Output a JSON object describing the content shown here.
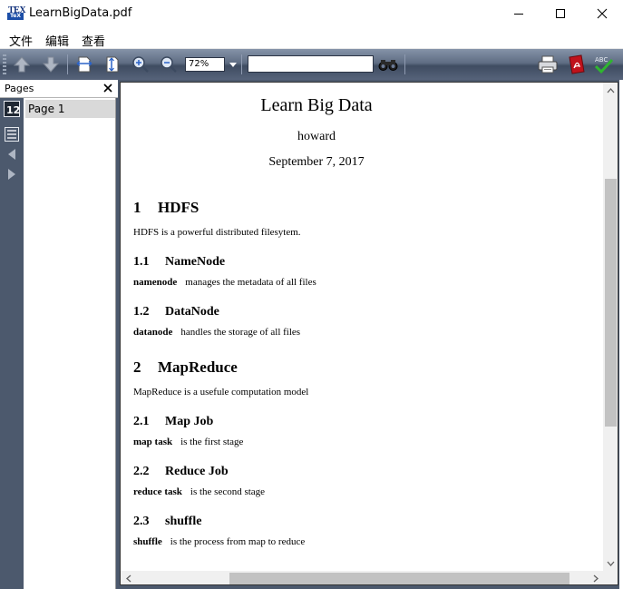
{
  "window": {
    "title": "LearnBigData.pdf",
    "app_icon_top": "TEX",
    "app_icon_bottom": "TeX"
  },
  "menu": {
    "items": [
      {
        "label": "文件"
      },
      {
        "label": "编辑"
      },
      {
        "label": "查看"
      }
    ]
  },
  "toolbar": {
    "zoom_value": "72%",
    "search_value": ""
  },
  "pages_panel": {
    "title": "Pages",
    "page_number_icon": "12",
    "items": [
      {
        "label": "Page 1"
      }
    ]
  },
  "document": {
    "title": "Learn Big Data",
    "author": "howard",
    "date": "September 7, 2017",
    "sections": [
      {
        "num": "1",
        "title": "HDFS",
        "text": "HDFS is a powerful distributed filesytem.",
        "subsections": [
          {
            "num": "1.1",
            "title": "NameNode",
            "term": "namenode",
            "text": "manages the metadata of all files"
          },
          {
            "num": "1.2",
            "title": "DataNode",
            "term": "datanode",
            "text": "handles the storage of all files"
          }
        ]
      },
      {
        "num": "2",
        "title": "MapReduce",
        "text": "MapReduce is a usefule computation model",
        "subsections": [
          {
            "num": "2.1",
            "title": "Map Job",
            "term": "map task",
            "text": "is the first stage"
          },
          {
            "num": "2.2",
            "title": "Reduce Job",
            "term": "reduce task",
            "text": "is the second stage"
          },
          {
            "num": "2.3",
            "title": "shuffle",
            "term": "shuffle",
            "text": "is the process from map to reduce"
          }
        ]
      }
    ]
  },
  "colors": {
    "toolbar_top": "#8593a8",
    "toolbar_bottom": "#3f4c61",
    "panel_bg": "#4c596d",
    "selected_page": "#d9d9d9"
  }
}
